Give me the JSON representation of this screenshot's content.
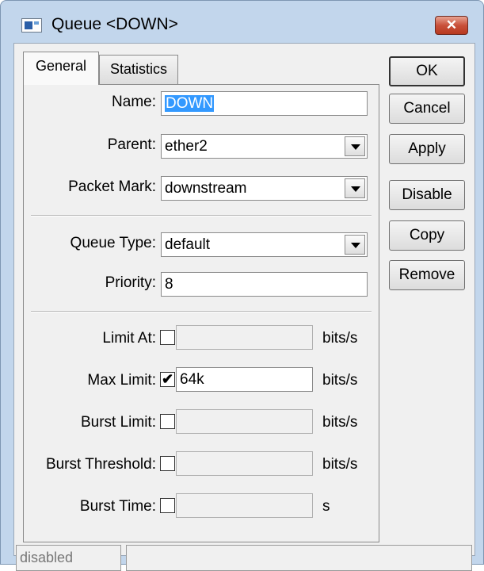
{
  "window": {
    "title": "Queue <DOWN>",
    "close_glyph": "✕",
    "icon": "winbox-queue-icon"
  },
  "tabs": [
    {
      "label": "General",
      "active": true
    },
    {
      "label": "Statistics",
      "active": false
    }
  ],
  "fields": {
    "name": {
      "label": "Name:",
      "value": "DOWN",
      "selected": true
    },
    "parent": {
      "label": "Parent:",
      "value": "ether2"
    },
    "packet_mark": {
      "label": "Packet Mark:",
      "value": "downstream"
    },
    "queue_type": {
      "label": "Queue Type:",
      "value": "default"
    },
    "priority": {
      "label": "Priority:",
      "value": "8"
    },
    "limit_at": {
      "label": "Limit At:",
      "checked": false,
      "value": "",
      "unit": "bits/s"
    },
    "max_limit": {
      "label": "Max Limit:",
      "checked": true,
      "check_glyph": "✔",
      "value": "64k",
      "unit": "bits/s"
    },
    "burst_limit": {
      "label": "Burst Limit:",
      "checked": false,
      "value": "",
      "unit": "bits/s"
    },
    "burst_threshold": {
      "label": "Burst Threshold:",
      "checked": false,
      "value": "",
      "unit": "bits/s"
    },
    "burst_time": {
      "label": "Burst Time:",
      "checked": false,
      "value": "",
      "unit": "s"
    }
  },
  "buttons": {
    "ok": "OK",
    "cancel": "Cancel",
    "apply": "Apply",
    "disable": "Disable",
    "copy": "Copy",
    "remove": "Remove"
  },
  "status": {
    "text": "disabled",
    "extra": ""
  },
  "colors": {
    "frame": "#c2d6ec",
    "selection": "#3399ff",
    "close_button": "#c9503a"
  }
}
